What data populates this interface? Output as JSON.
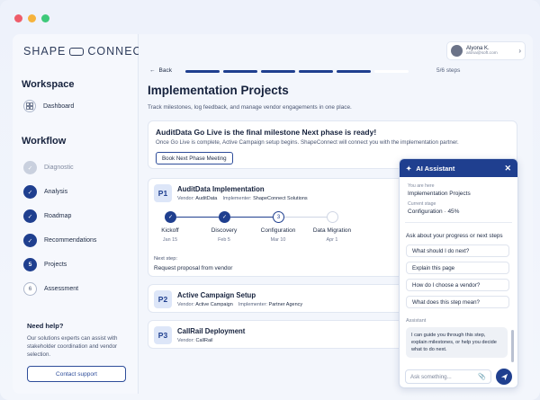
{
  "window": {
    "dot_colors": [
      "#ee5d6a",
      "#f6b33c",
      "#3ec97a"
    ]
  },
  "brand": {
    "left": "SHAPE",
    "right": "CONNECT"
  },
  "sidebar": {
    "workspace_title": "Workspace",
    "dashboard_label": "Dashboard",
    "workflow_title": "Workflow",
    "steps": [
      {
        "label": "Diagnostic",
        "state": "muted",
        "num": "✓"
      },
      {
        "label": "Analysis",
        "state": "done",
        "num": "✓"
      },
      {
        "label": "Roadmap",
        "state": "done",
        "num": "✓"
      },
      {
        "label": "Recommendations",
        "state": "done",
        "num": "✓"
      },
      {
        "label": "Projects",
        "state": "current",
        "num": "5"
      },
      {
        "label": "Assessment",
        "state": "next",
        "num": "6"
      }
    ],
    "help_title": "Need help?",
    "help_text": "Our solutions experts can assist with stakeholder coordination and vendor selection.",
    "help_button": "Contact support"
  },
  "user": {
    "name": "Alyona K.",
    "email": "alona@soft.com"
  },
  "nav": {
    "back_label": "Back",
    "progress_text": "5/6 steps",
    "progress_done": 5,
    "progress_total": 6,
    "accent": "#1f3f8f"
  },
  "page": {
    "title": "Implementation Projects",
    "subtitle": "Track milestones, log feedback, and manage vendor engagements in one place."
  },
  "banner": {
    "title": "AuditData Go Live is the final milestone  Next phase is ready!",
    "text": "Once Go Live is complete, Active Campaign setup begins. ShapeConnect will connect you with the implementation partner.",
    "button": "Book Next Phase Meeting"
  },
  "projects": [
    {
      "badge": "P1",
      "title": "AuditData Implementation",
      "vendor_label": "Vendor:",
      "vendor": "AuditData",
      "implementer_label": "Implementer:",
      "implementer": "ShapeConnect Solutions",
      "milestones": [
        {
          "label": "Kickoff",
          "date": "Jan 15",
          "state": "done",
          "mark": "✓"
        },
        {
          "label": "Discovery",
          "date": "Feb 5",
          "state": "done",
          "mark": "✓"
        },
        {
          "label": "Configuration",
          "date": "Mar 10",
          "state": "current",
          "mark": "3"
        },
        {
          "label": "Data Migration",
          "date": "Apr 1",
          "state": "next",
          "mark": ""
        }
      ],
      "next_step_label": "Next step:",
      "next_step": "Request proposal from vendor"
    },
    {
      "badge": "P2",
      "title": "Active Campaign Setup",
      "vendor_label": "Vendor:",
      "vendor": "Active Campaign",
      "implementer_label": "Implementer:",
      "implementer": "Partner Agency"
    },
    {
      "badge": "P3",
      "title": "CallRail Deployment",
      "vendor_label": "Vendor:",
      "vendor": "CallRail"
    }
  ],
  "assistant": {
    "title": "AI Assistant",
    "here_label": "You are here",
    "here_value": "Implementation Projects",
    "stage_label": "Current stage",
    "stage_value": "Configuration · 45%",
    "ask_label": "Ask about your progress or next steps",
    "suggestions": [
      "What should I do next?",
      "Explain this page",
      "How do I choose a vendor?",
      "What does this step mean?"
    ],
    "reply_label": "Assistant",
    "reply": "I can guide you through this step, explain milestones, or help you decide what to do next.",
    "input_placeholder": "Ask something..."
  }
}
